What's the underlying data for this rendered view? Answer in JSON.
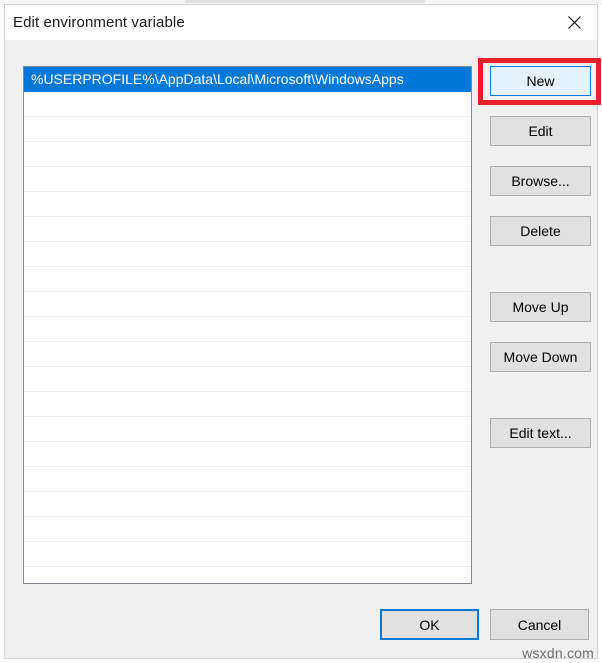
{
  "window": {
    "title": "Edit environment variable",
    "close_icon": "close-icon"
  },
  "listbox": {
    "rows": [
      {
        "text": "%USERPROFILE%\\AppData\\Local\\Microsoft\\WindowsApps",
        "selected": true
      },
      {
        "text": "",
        "selected": false
      },
      {
        "text": "",
        "selected": false
      },
      {
        "text": "",
        "selected": false
      },
      {
        "text": "",
        "selected": false
      },
      {
        "text": "",
        "selected": false
      },
      {
        "text": "",
        "selected": false
      },
      {
        "text": "",
        "selected": false
      },
      {
        "text": "",
        "selected": false
      },
      {
        "text": "",
        "selected": false
      },
      {
        "text": "",
        "selected": false
      },
      {
        "text": "",
        "selected": false
      },
      {
        "text": "",
        "selected": false
      },
      {
        "text": "",
        "selected": false
      },
      {
        "text": "",
        "selected": false
      },
      {
        "text": "",
        "selected": false
      },
      {
        "text": "",
        "selected": false
      },
      {
        "text": "",
        "selected": false
      },
      {
        "text": "",
        "selected": false
      },
      {
        "text": "",
        "selected": false
      },
      {
        "text": "",
        "selected": false
      }
    ]
  },
  "side_buttons": {
    "new": "New",
    "edit": "Edit",
    "browse": "Browse...",
    "delete": "Delete",
    "move_up": "Move Up",
    "move_down": "Move Down",
    "edit_text": "Edit text..."
  },
  "bottom_buttons": {
    "ok": "OK",
    "cancel": "Cancel"
  },
  "annotation": {
    "target": "New",
    "color": "#e8202a"
  },
  "watermark": {
    "text": "wsxdn.com"
  },
  "colors": {
    "selection_blue": "#0078d7",
    "dialog_background": "#f0f0f0",
    "button_face": "#e1e1e1",
    "button_border": "#adadad",
    "focus_fill": "#e5f1fb",
    "listbox_border": "#828790",
    "row_separator": "#ededed",
    "annotation_red": "#e8202a"
  }
}
